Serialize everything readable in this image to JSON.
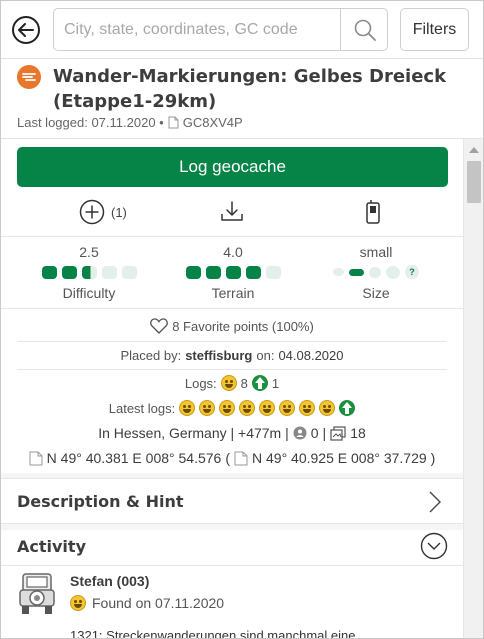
{
  "search": {
    "placeholder": "City, state, coordinates, GC code"
  },
  "filters_label": "Filters",
  "cache": {
    "title": "Wander-Markierungen: Gelbes Dreieck (Etappe1-29km)",
    "last_logged": "Last logged: 07.11.2020 •",
    "gc_code": "GC8XV4P"
  },
  "actions": {
    "log_button": "Log geocache",
    "add_count": "(1)"
  },
  "ratings": {
    "difficulty": {
      "value": "2.5",
      "label": "Difficulty",
      "level": 2.5
    },
    "terrain": {
      "value": "4.0",
      "label": "Terrain",
      "level": 4
    },
    "size": {
      "value": "small",
      "label": "Size",
      "unknown_mark": "?"
    }
  },
  "favorites": "8 Favorite points (100%)",
  "placed": {
    "prefix": "Placed by:",
    "owner": "steffisburg",
    "on_label": "on:",
    "date": "04.08.2020"
  },
  "logs": {
    "label": "Logs:",
    "found_count": "8",
    "other_count": "1"
  },
  "latest_logs_label": "Latest logs:",
  "location": {
    "text": "In Hessen, Germany | +477m |",
    "trackables": "0",
    "sep": "|",
    "images": "18"
  },
  "coords": {
    "original": "N 49° 40.381 E 008° 54.576",
    "open_paren": "(",
    "corrected": "N 49° 40.925 E 008° 37.729",
    "close_paren": ")"
  },
  "sections": {
    "description": "Description & Hint",
    "activity": "Activity"
  },
  "log_entry": {
    "user": "Stefan (003)",
    "type": "Found on 07.11.2020",
    "text": "1321: Streckenwanderungen sind manchmal eine"
  }
}
